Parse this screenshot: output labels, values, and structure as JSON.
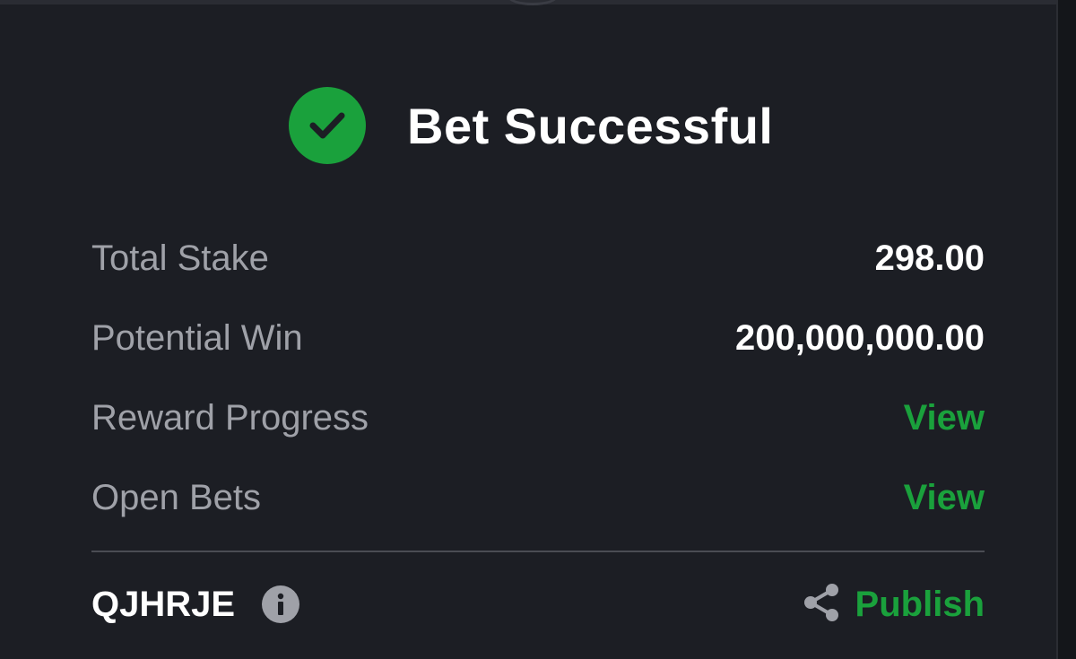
{
  "dialog": {
    "title": "Bet Successful",
    "accent_color": "#1aa13c",
    "icons": {
      "success": "check-circle-icon",
      "info": "info-icon",
      "share": "share-icon"
    }
  },
  "summary": {
    "total_stake": {
      "label": "Total Stake",
      "value": "298.00"
    },
    "potential_win": {
      "label": "Potential Win",
      "value": "200,000,000.00"
    },
    "reward_progress": {
      "label": "Reward Progress",
      "link": "View"
    },
    "open_bets": {
      "label": "Open Bets",
      "link": "View"
    }
  },
  "footer": {
    "booking_code": "QJHRJE",
    "publish_label": "Publish"
  }
}
